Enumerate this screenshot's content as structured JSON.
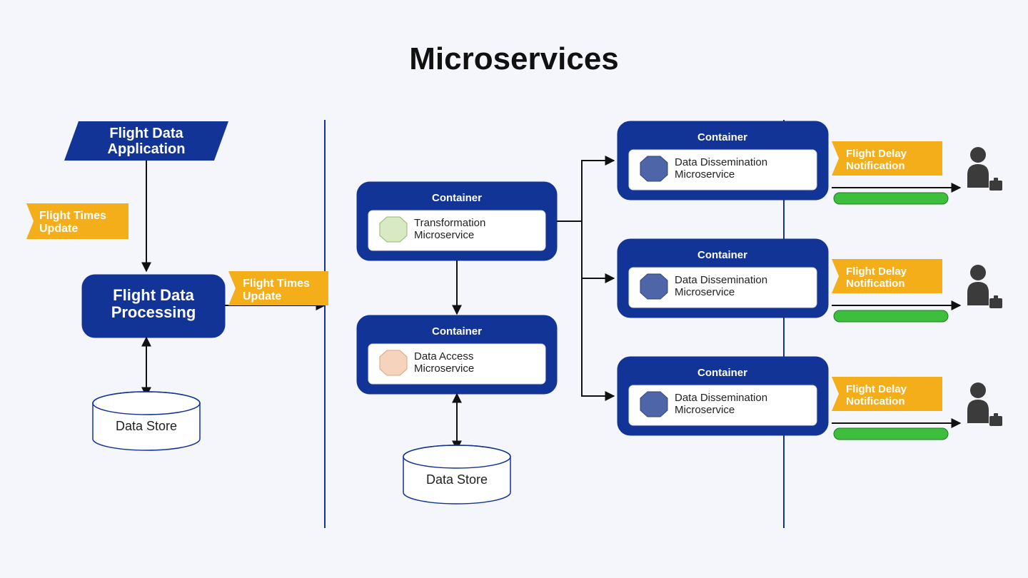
{
  "title": "Microservices",
  "flight_app": "Flight Data\nApplication",
  "flight_processing": "Flight Data\nProcessing",
  "label_times_update": "Flight Times\nUpdate",
  "data_store": "Data Store",
  "container_label": "Container",
  "ms_transformation": "Transformation\nMicroservice",
  "ms_data_access": "Data Access\nMicroservice",
  "ms_dissemination": "Data Dissemination\nMicroservice",
  "flight_delay": "Flight Delay\nNotification",
  "colors": {
    "blue": "#123497",
    "yellow": "#F3AE1A",
    "green": "#3DBE3D",
    "hexGreen": "#D8E9C4",
    "hexPeach": "#F6D3BC",
    "hexBlue": "#4E66A7",
    "person": "#3B3B3B"
  }
}
